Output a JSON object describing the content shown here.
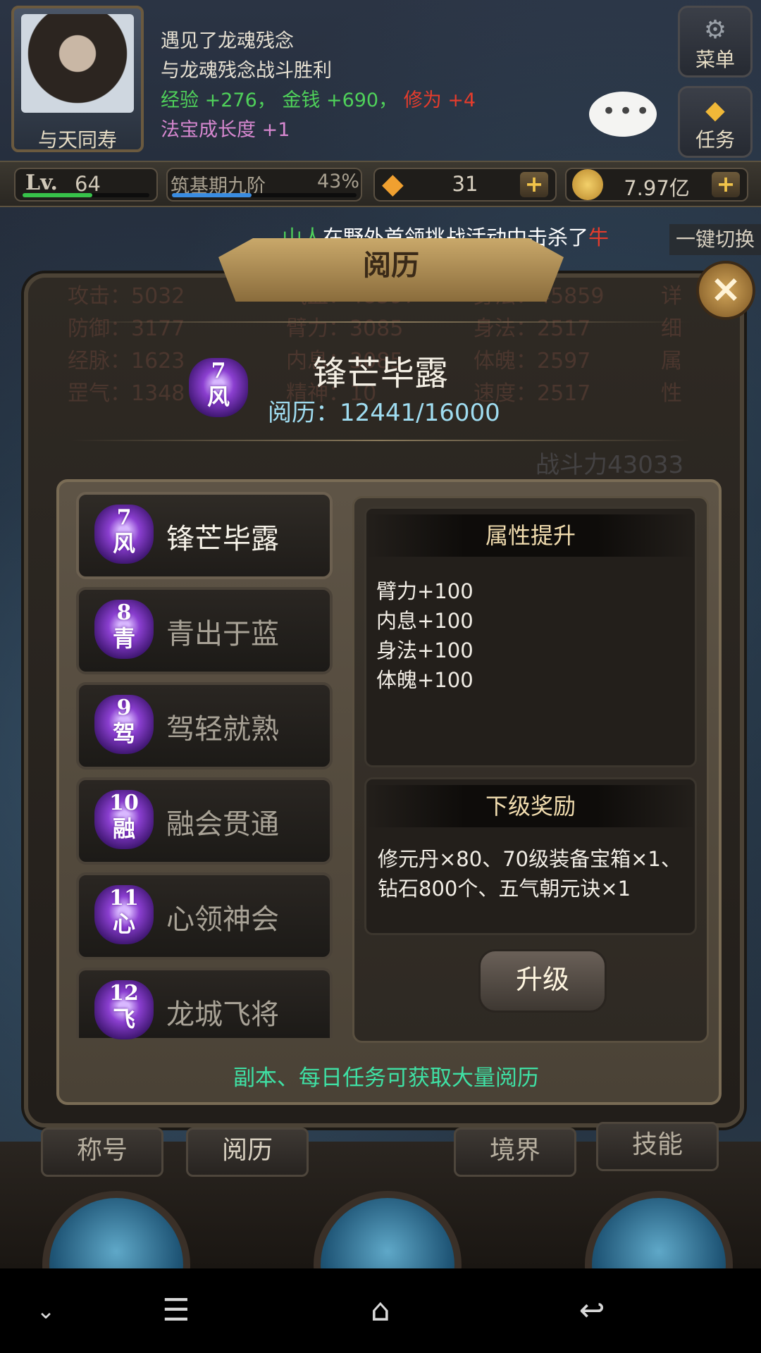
{
  "hud": {
    "avatar_name": "与天同寿",
    "log_lines": [
      {
        "text": "遇见了龙魂残念"
      },
      {
        "text": "与龙魂残念战斗胜利"
      }
    ],
    "reward_line": {
      "exp_label": "经验",
      "exp_value": "+276",
      "sep1": "，",
      "money_label": "金钱",
      "money_value": "+690",
      "sep2": "，",
      "cultivation_label": "修为",
      "cultivation_value": "+4"
    },
    "treasure_line": {
      "label": "法宝成长度",
      "value": "+1"
    },
    "menu_label": "菜单",
    "task_label": "任务",
    "chat_dots": "•••"
  },
  "statbar": {
    "level_prefix": "Lv.",
    "level": "64",
    "level_progress": 0.55,
    "realm": "筑基期九阶",
    "realm_percent": "43%",
    "realm_progress": 0.43,
    "gems": "31",
    "gold": "7.97亿",
    "plus": "+"
  },
  "broadcast": {
    "player": "山人",
    "message": "在野外首领挑战活动中击杀了",
    "target": "牛",
    "one_key": "一键切换"
  },
  "panel": {
    "title": "阅历",
    "close": "×",
    "ghost_stats": [
      [
        "攻击：5032",
        "气血：48397",
        "身法：45859",
        "详"
      ],
      [
        "防御：3177",
        "臂力：3085",
        "身法：2517",
        "细"
      ],
      [
        "经脉：1623",
        "内息：3085",
        "体魄：2597",
        "属"
      ],
      [
        "罡气：1348",
        "精神：10",
        "速度：2517",
        "性"
      ]
    ],
    "ghost_power": "战斗力43033",
    "current": {
      "rank_num": "7",
      "rank_char": "风",
      "name": "锋芒毕露",
      "exp_label": "阅历：",
      "exp_value": "12441/16000"
    },
    "list": [
      {
        "num": "7",
        "char": "风",
        "name": "锋芒毕露"
      },
      {
        "num": "8",
        "char": "青",
        "name": "青出于蓝"
      },
      {
        "num": "9",
        "char": "驾",
        "name": "驾轻就熟"
      },
      {
        "num": "10",
        "char": "融",
        "name": "融会贯通"
      },
      {
        "num": "11",
        "char": "心",
        "name": "心领神会"
      },
      {
        "num": "12",
        "char": "飞",
        "name": "龙城飞将"
      }
    ],
    "attr_box": {
      "title": "属性提升",
      "lines": [
        "臂力+100",
        "内息+100",
        "身法+100",
        "体魄+100"
      ]
    },
    "reward_box": {
      "title": "下级奖励",
      "lines": [
        "修元丹×80、70级装备宝箱×1、",
        "钻石800个、五气朝元诀×1"
      ]
    },
    "upgrade_label": "升级",
    "hint": "副本、每日任务可获取大量阅历"
  },
  "tabs": [
    "称号",
    "阅历",
    "境界",
    "技能"
  ],
  "colors": {
    "accent_green": "#4fd15a",
    "accent_red": "#e53c2c",
    "hint_green": "#3fe0a4",
    "exp_blue": "#9fdcf0",
    "badge_purple": "#8b3fd0"
  },
  "icons": {
    "menu": "gear-icon",
    "task": "diamond-icon",
    "gem": "gem-icon",
    "coin": "coin-icon"
  }
}
